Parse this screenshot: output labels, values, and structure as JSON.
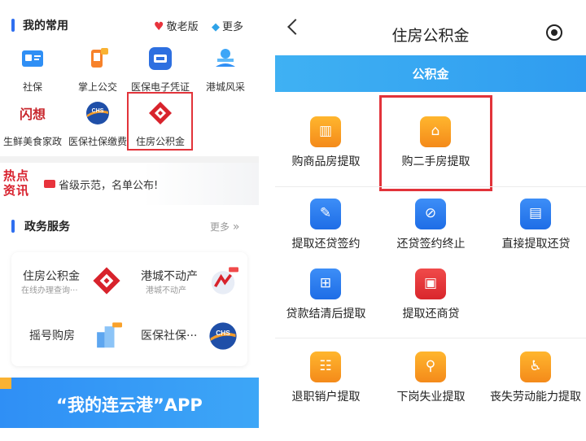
{
  "left": {
    "section_title": "我的常用",
    "elder_mode": "敬老版",
    "more": "更多",
    "apps": [
      {
        "label": "社保",
        "icon": "social-security-icon"
      },
      {
        "label": "掌上公交",
        "icon": "bus-icon"
      },
      {
        "label": "医保电子凭证",
        "icon": "medical-insurance-icon"
      },
      {
        "label": "港城风采",
        "icon": "city-scenery-icon"
      },
      {
        "label": "生鲜美食家政",
        "icon": "fresh-food-icon"
      },
      {
        "label": "医保社保缴费",
        "icon": "chs-icon"
      },
      {
        "label": "住房公积金",
        "icon": "housing-fund-icon"
      }
    ],
    "flash_logo": "闪想",
    "hot_title": "热点资讯",
    "hot_text": "省级示范，名单公布!",
    "gov_title": "政务服务",
    "gov_more": "更多",
    "services": [
      {
        "name": "住房公积金",
        "sub": "在线办理查询···"
      },
      {
        "name": "港城不动产",
        "sub": "港城不动产"
      },
      {
        "name": "摇号购房",
        "sub": ""
      },
      {
        "name": "医保社保···",
        "sub": ""
      }
    ],
    "banner": "“我的连云港”APP"
  },
  "right": {
    "title": "住房公积金",
    "tab": "公积金",
    "items": [
      {
        "label": "购商品房提取",
        "color": "orange"
      },
      {
        "label": "购二手房提取",
        "color": "orange"
      },
      {
        "label": "提取还贷签约",
        "color": "blue"
      },
      {
        "label": "还贷签约终止",
        "color": "blue"
      },
      {
        "label": "直接提取还贷",
        "color": "blue"
      },
      {
        "label": "贷款结清后提取",
        "color": "blue"
      },
      {
        "label": "提取还商贷",
        "color": "red"
      },
      {
        "label": "退职销户提取",
        "color": "orange"
      },
      {
        "label": "下岗失业提取",
        "color": "orange"
      },
      {
        "label": "丧失劳动能力提取",
        "color": "orange"
      }
    ]
  },
  "colors": {
    "accent": "#2f6ff0",
    "highlight": "#e2333a",
    "tab": "#3fb1f3",
    "orange": "#f7a12a"
  }
}
